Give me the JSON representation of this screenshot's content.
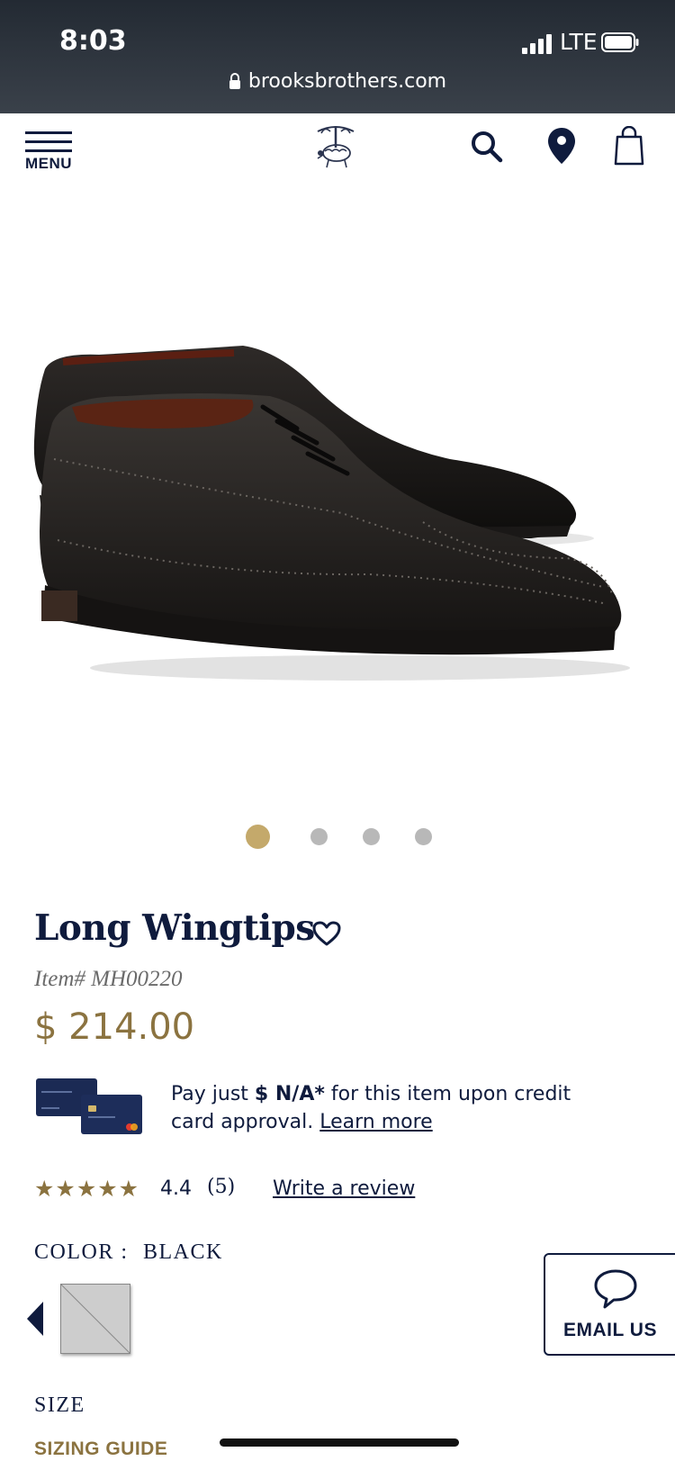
{
  "status_bar": {
    "time": "8:03",
    "network": "LTE",
    "url": "brooksbrothers.com"
  },
  "nav": {
    "menu_label": "MENU",
    "icons": [
      "search-icon",
      "location-icon",
      "bag-icon"
    ]
  },
  "gallery": {
    "image_count": 4,
    "active_index": 0
  },
  "product": {
    "title": "Long Wingtips",
    "item_number": "Item# MH00220",
    "price": "$ 214.00"
  },
  "credit_offer": {
    "prefix": "Pay just ",
    "amount": "$ N/A*",
    "suffix": " for this item upon credit card approval. ",
    "link": "Learn more"
  },
  "reviews": {
    "stars": "★★★★★",
    "rating": "4.4",
    "count": "(5)",
    "write_link": "Write a review"
  },
  "color": {
    "label": "COLOR :",
    "value": "BLACK"
  },
  "email_us": {
    "label": "EMAIL US"
  },
  "size": {
    "label": "SIZE",
    "guide_link": "SIZING GUIDE"
  },
  "colors": {
    "navy": "#0f1b3d",
    "gold": "#8b7340",
    "dot_inactive": "#b8b8b8",
    "dot_active": "#c4a96b"
  }
}
